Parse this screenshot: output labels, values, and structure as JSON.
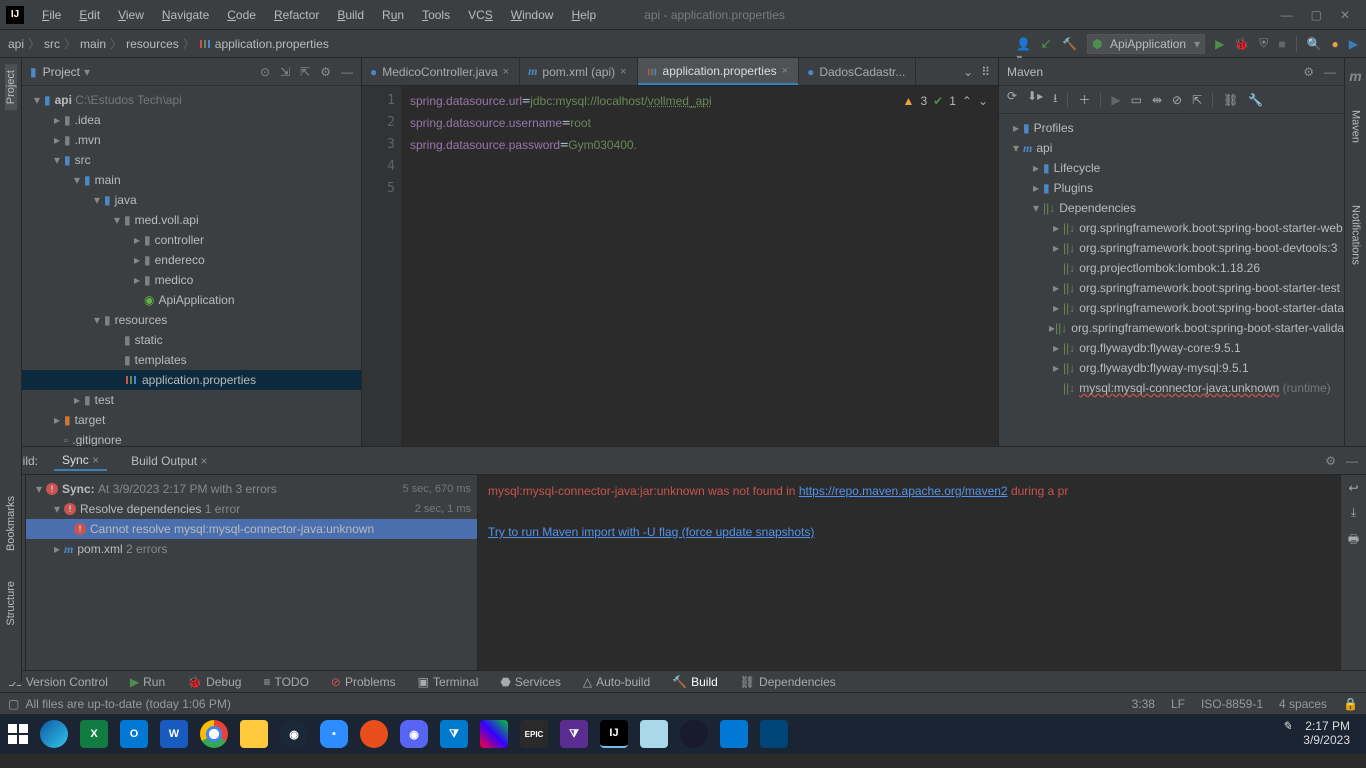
{
  "window": {
    "title": "api - application.properties"
  },
  "menu": [
    "File",
    "Edit",
    "View",
    "Navigate",
    "Code",
    "Refactor",
    "Build",
    "Run",
    "Tools",
    "VCS",
    "Window",
    "Help"
  ],
  "breadcrumbs": [
    "api",
    "src",
    "main",
    "resources",
    "application.properties"
  ],
  "runConfig": "ApiApplication",
  "projectPanel": {
    "title": "Project",
    "tree": {
      "root": {
        "name": "api",
        "path": "C:\\Estudos Tech\\api"
      },
      "idea": ".idea",
      "mvn": ".mvn",
      "src": "src",
      "main": "main",
      "java": "java",
      "pkg": "med.voll.api",
      "controller": "controller",
      "endereco": "endereco",
      "medico": "medico",
      "apiApp": "ApiApplication",
      "resources": "resources",
      "static": "static",
      "templates": "templates",
      "appprops": "application.properties",
      "test": "test",
      "target": "target",
      "gitignore": ".gitignore"
    }
  },
  "tabs": [
    {
      "label": "MedicoController.java",
      "icon": "java"
    },
    {
      "label": "pom.xml (api)",
      "icon": "maven"
    },
    {
      "label": "application.properties",
      "icon": "props",
      "active": true
    },
    {
      "label": "DadosCadastr...",
      "icon": "java"
    }
  ],
  "editor": {
    "lines": [
      "spring.datasource.url=jdbc:mysql://localhost/vollmed_api",
      "spring.datasource.username=root",
      "spring.datasource.password=Gym030400."
    ],
    "warnings": "3",
    "weak": "1"
  },
  "mavenPanel": {
    "title": "Maven",
    "root": "Profiles",
    "api": "api",
    "lifecycle": "Lifecycle",
    "plugins": "Plugins",
    "dependencies": "Dependencies",
    "deps": [
      "org.springframework.boot:spring-boot-starter-web",
      "org.springframework.boot:spring-boot-devtools:3",
      "org.projectlombok:lombok:1.18.26",
      "org.springframework.boot:spring-boot-starter-test",
      "org.springframework.boot:spring-boot-starter-data",
      "org.springframework.boot:spring-boot-starter-validation",
      "org.flywaydb:flyway-core:9.5.1",
      "org.flywaydb:flyway-mysql:9.5.1"
    ],
    "depUnknown": "mysql:mysql-connector-java:unknown",
    "depUnknownTag": "(runtime)"
  },
  "buildPanel": {
    "label": "Build:",
    "syncTab": "Sync",
    "outputTab": "Build Output",
    "sync": {
      "title": "Sync:",
      "detail": "At 3/9/2023 2:17 PM with 3 errors",
      "time": "5 sec, 670 ms"
    },
    "resolve": {
      "title": "Resolve dependencies",
      "detail": "1 error",
      "time": "2 sec, 1 ms"
    },
    "error": "Cannot resolve mysql:mysql-connector-java:unknown",
    "pom": {
      "title": "pom.xml",
      "detail": "2 errors"
    },
    "output": {
      "errPrefix": "mysql:mysql-connector-java:jar:unknown was not found in ",
      "link1": "https://repo.maven.apache.org/maven2",
      "errSuffix": " during a pr",
      "link2": "Try to run Maven import with -U flag (force update snapshots)"
    }
  },
  "toolwindows": [
    "Version Control",
    "Run",
    "Debug",
    "TODO",
    "Problems",
    "Terminal",
    "Services",
    "Auto-build",
    "Build",
    "Dependencies"
  ],
  "statusbar": {
    "msg": "All files are up-to-date (today 1:06 PM)",
    "pos": "3:38",
    "lf": "LF",
    "enc": "ISO-8859-1",
    "indent": "4 spaces"
  },
  "rightRail": {
    "maven": "Maven",
    "notif": "Notifications"
  },
  "leftRail": {
    "project": "Project",
    "bookmarks": "Bookmarks",
    "structure": "Structure"
  },
  "clock": {
    "time": "2:17 PM",
    "date": "3/9/2023"
  }
}
